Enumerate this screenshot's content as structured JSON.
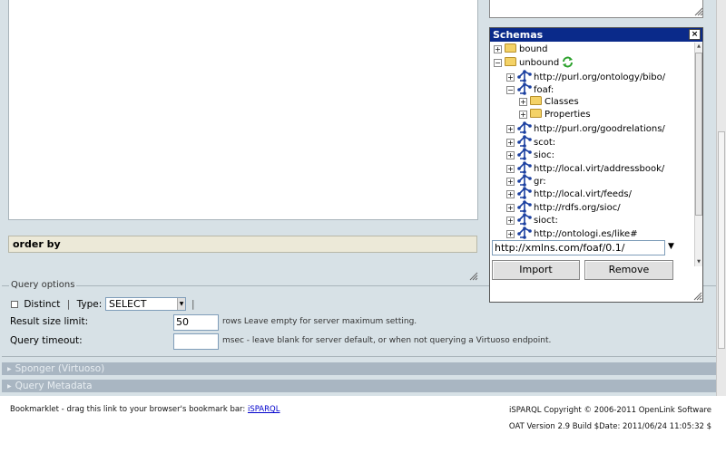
{
  "editor": {
    "order_by_label": "order by"
  },
  "schemas": {
    "title": "Schemas",
    "close_label": "×",
    "tree": [
      {
        "toggle": "+",
        "type": "folder",
        "label": "bound",
        "indent": 0
      },
      {
        "toggle": "−",
        "type": "folder",
        "label": "unbound",
        "indent": 0,
        "refresh": true
      },
      {
        "toggle": "+",
        "type": "ns",
        "label": "http://purl.org/ontology/bibo/",
        "indent": 1
      },
      {
        "toggle": "−",
        "type": "ns",
        "label": "foaf:",
        "indent": 1
      },
      {
        "toggle": "+",
        "type": "folder",
        "label": "Classes",
        "indent": 2
      },
      {
        "toggle": "+",
        "type": "folder",
        "label": "Properties",
        "indent": 2
      },
      {
        "toggle": "+",
        "type": "ns",
        "label": "http://purl.org/goodrelations/",
        "indent": 1
      },
      {
        "toggle": "+",
        "type": "ns",
        "label": "scot:",
        "indent": 1
      },
      {
        "toggle": "+",
        "type": "ns",
        "label": "sioc:",
        "indent": 1
      },
      {
        "toggle": "+",
        "type": "ns",
        "label": "http://local.virt/addressbook/",
        "indent": 1
      },
      {
        "toggle": "+",
        "type": "ns",
        "label": "gr:",
        "indent": 1
      },
      {
        "toggle": "+",
        "type": "ns",
        "label": "http://local.virt/feeds/",
        "indent": 1
      },
      {
        "toggle": "+",
        "type": "ns",
        "label": "http://rdfs.org/sioc/",
        "indent": 1
      },
      {
        "toggle": "+",
        "type": "ns",
        "label": "sioct:",
        "indent": 1
      },
      {
        "toggle": "+",
        "type": "ns",
        "label": "http://ontologi.es/like#",
        "indent": 1
      }
    ],
    "namespace_value": "http://xmlns.com/foaf/0.1/",
    "import_label": "Import",
    "remove_label": "Remove"
  },
  "query_options": {
    "legend": "Query options",
    "distinct_label": "Distinct",
    "separator": "|",
    "type_label": "Type:",
    "type_value": "SELECT",
    "result_limit_label": "Result size limit:",
    "result_limit_value": "50",
    "result_limit_hint": "rows Leave empty for server maximum setting.",
    "timeout_label": "Query timeout:",
    "timeout_value": "",
    "timeout_hint": "msec - leave blank for server default, or when not querying a Virtuoso endpoint."
  },
  "sections": {
    "sponger": "Sponger (Virtuoso)",
    "metadata": "Query Metadata"
  },
  "footer": {
    "bookmarklet_text": "Bookmarklet - drag this link to your browser's bookmark bar:",
    "bookmarklet_link": "iSPARQL",
    "copyright": "iSPARQL Copyright © 2006-2011 OpenLink Software",
    "version": "OAT Version 2.9 Build $Date: 2011/06/24 11:05:32 $"
  },
  "colors": {
    "app_bg": "#d7e1e6",
    "title_bar": "#0a2a8a",
    "section_bar": "#a9b6c2",
    "link": "#0000cc"
  }
}
